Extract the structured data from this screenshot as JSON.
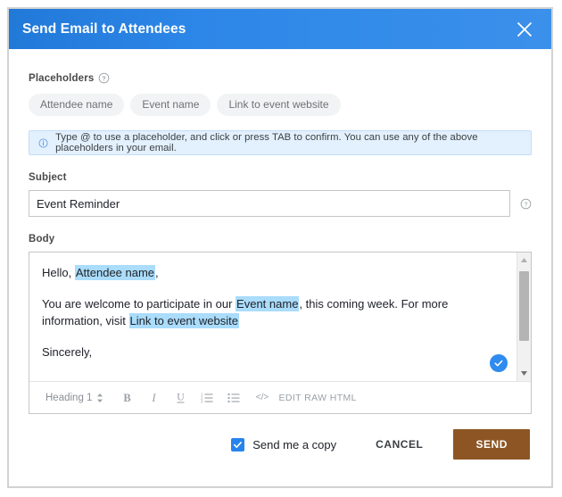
{
  "dialog": {
    "title": "Send Email to Attendees",
    "close_icon": "close-icon",
    "header_color": "#2d87e8"
  },
  "placeholders": {
    "label": "Placeholders",
    "help_icon": "help-circle-icon",
    "chips": [
      {
        "label": "Attendee name"
      },
      {
        "label": "Event name"
      },
      {
        "label": "Link to event website"
      }
    ]
  },
  "info_banner": {
    "icon": "info-circle-icon",
    "text": "Type @ to use a placeholder, and click or press TAB to confirm. You can use any of the above placeholders in your email.",
    "background": "#e3f0fd",
    "border": "#c3def7"
  },
  "subject": {
    "label": "Subject",
    "value": "Event Reminder",
    "placeholder": "",
    "help_icon": "help-circle-icon"
  },
  "body": {
    "label": "Body",
    "lines": {
      "greeting_prefix": "Hello, ",
      "greeting_placeholder": "Attendee name",
      "greeting_suffix": ",",
      "paragraph_prefix": "You are welcome to participate in our ",
      "paragraph_placeholder": "Event name",
      "paragraph_middle": ", this coming week. For more information, visit",
      "paragraph_link_placeholder": "Link to event website",
      "signoff": "Sincerely,"
    },
    "highlight_color": "#aadcfb",
    "confirm_icon": "check-circle-icon",
    "scrollbar": {
      "up_icon": "scroll-up-arrow-icon",
      "down_icon": "scroll-down-arrow-icon"
    }
  },
  "toolbar": {
    "heading_label": "Heading 1",
    "heading_caret_icon": "updown-caret-icon",
    "bold_label": "B",
    "italic_label": "I",
    "underline_label": "U",
    "ordered_list_icon": "ordered-list-icon",
    "bullet_list_icon": "bullet-list-icon",
    "code_icon": "code-brackets-icon",
    "raw_html_label": "EDIT RAW HTML"
  },
  "footer": {
    "checkbox_label": "Send me a copy",
    "checkbox_checked": true,
    "checkbox_color": "#2684ec",
    "cancel_label": "CANCEL",
    "send_label": "SEND",
    "send_color": "#8d5524"
  }
}
